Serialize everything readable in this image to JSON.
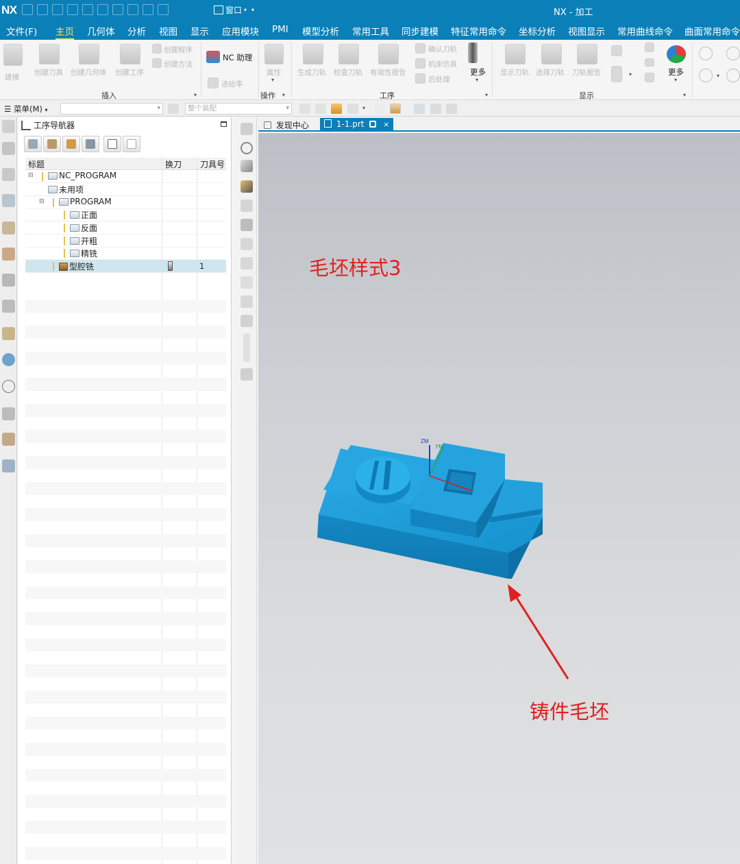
{
  "titlebar": {
    "logo": "NX",
    "window_menu": "窗口",
    "app_title": "NX - 加工"
  },
  "menu_tabs": [
    {
      "label": "文件(F)"
    },
    {
      "label": "主页",
      "active": true
    },
    {
      "label": "几何体"
    },
    {
      "label": "分析"
    },
    {
      "label": "视图"
    },
    {
      "label": "显示"
    },
    {
      "label": "应用模块"
    },
    {
      "label": "PMI"
    },
    {
      "label": "模型分析"
    },
    {
      "label": "常用工具"
    },
    {
      "label": "同步建模"
    },
    {
      "label": "特征常用命令"
    },
    {
      "label": "坐标分析"
    },
    {
      "label": "视图显示"
    },
    {
      "label": "常用曲线命令"
    },
    {
      "label": "曲面常用命令"
    }
  ],
  "ribbon": {
    "build": "建模",
    "create_tool": "创建刀具",
    "create_geometry": "创建几何体",
    "create_operation": "创建工序",
    "create_program": "创建程序",
    "create_method": "创建方法",
    "nc_assistant": "NC 助理",
    "feed_rate": "进给率",
    "properties": "属性",
    "generate_path": "生成刀轨",
    "verify_path": "检查刀轨",
    "validity_report": "有效性报告",
    "confirm_path": "确认刀轨",
    "machine_sim": "机床仿真",
    "postprocess": "后处理",
    "more": "更多",
    "show_path": "显示刀轨",
    "select_path": "选择刀轨",
    "path_report": "刀轨报告",
    "more2": "更多",
    "groups": {
      "insert": "插入",
      "operation": "操作",
      "procedure": "工序",
      "display": "显示"
    }
  },
  "selection_bar": {
    "menu": "菜单(M)",
    "scope": "整个装配"
  },
  "navigator": {
    "title": "工序导航器",
    "columns": [
      "标题",
      "换刀",
      "刀具号"
    ],
    "rows": [
      {
        "name": "NC_PROGRAM",
        "indent": 0,
        "kind": "folder",
        "tool_change": "",
        "tool_no": ""
      },
      {
        "name": "未用项",
        "indent": 1,
        "kind": "folder",
        "tool_change": "",
        "tool_no": ""
      },
      {
        "name": "PROGRAM",
        "indent": 1,
        "kind": "folder",
        "tool_change": "",
        "tool_no": ""
      },
      {
        "name": "正面",
        "indent": 2,
        "kind": "folder",
        "tool_change": "",
        "tool_no": ""
      },
      {
        "name": "反面",
        "indent": 2,
        "kind": "folder",
        "tool_change": "",
        "tool_no": ""
      },
      {
        "name": "开粗",
        "indent": 2,
        "kind": "folder",
        "tool_change": "",
        "tool_no": ""
      },
      {
        "name": "精铣",
        "indent": 2,
        "kind": "folder",
        "tool_change": "",
        "tool_no": ""
      },
      {
        "name": "型腔铣",
        "indent": 1,
        "kind": "operation",
        "tool_change": "",
        "tool_no": "1"
      }
    ]
  },
  "doc_tabs": [
    {
      "label": "发现中心"
    },
    {
      "label": "1-1.prt",
      "active": true
    }
  ],
  "viewport": {
    "annotation_top": "毛坯样式3",
    "annotation_bottom": "铸件毛坯",
    "axis_zm": "ZM",
    "axis_ym": "YM",
    "part_color": "#1a9ad6",
    "annotation_color": "#e21f1f"
  }
}
